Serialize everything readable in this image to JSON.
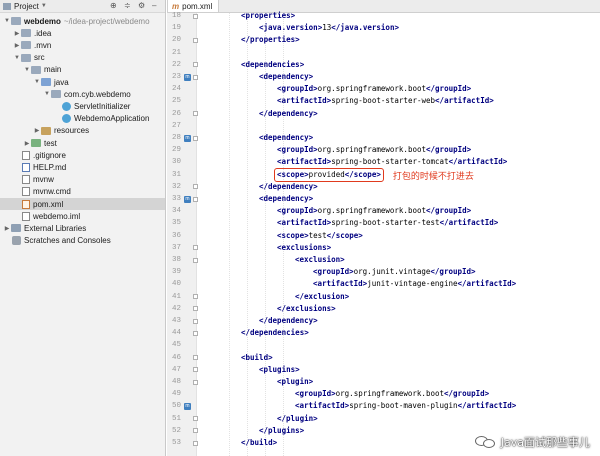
{
  "project_panel": {
    "title": "Project",
    "toolbar_icons": [
      "globe-icon",
      "split-icon",
      "gear-icon",
      "minimize-icon"
    ],
    "tree": [
      {
        "label": "webdemo",
        "path": "~/idea-project/webdemo",
        "depth": 0,
        "icon": "folder",
        "expanded": true,
        "bold": true
      },
      {
        "label": ".idea",
        "depth": 1,
        "icon": "folder",
        "expanded": false
      },
      {
        "label": ".mvn",
        "depth": 1,
        "icon": "folder",
        "expanded": false
      },
      {
        "label": "src",
        "depth": 1,
        "icon": "folder",
        "expanded": true
      },
      {
        "label": "main",
        "depth": 2,
        "icon": "folder",
        "expanded": true
      },
      {
        "label": "java",
        "depth": 3,
        "icon": "folder-src",
        "expanded": true
      },
      {
        "label": "com.cyb.webdemo",
        "depth": 4,
        "icon": "folder",
        "expanded": true
      },
      {
        "label": "ServletInitializer",
        "depth": 5,
        "icon": "class"
      },
      {
        "label": "WebdemoApplication",
        "depth": 5,
        "icon": "class"
      },
      {
        "label": "resources",
        "depth": 3,
        "icon": "folder-res",
        "expanded": false
      },
      {
        "label": "test",
        "depth": 2,
        "icon": "folder-test",
        "expanded": false
      },
      {
        "label": ".gitignore",
        "depth": 1,
        "icon": "file"
      },
      {
        "label": "HELP.md",
        "depth": 1,
        "icon": "file-md"
      },
      {
        "label": "mvnw",
        "depth": 1,
        "icon": "file"
      },
      {
        "label": "mvnw.cmd",
        "depth": 1,
        "icon": "file"
      },
      {
        "label": "pom.xml",
        "depth": 1,
        "icon": "file-xml",
        "selected": true
      },
      {
        "label": "webdemo.iml",
        "depth": 1,
        "icon": "file"
      },
      {
        "label": "External Libraries",
        "depth": 0,
        "icon": "folder-lib",
        "expanded": false
      },
      {
        "label": "Scratches and Consoles",
        "depth": 0,
        "icon": "scratch"
      }
    ]
  },
  "editor": {
    "tab_label": "pom.xml",
    "lines": [
      {
        "n": 18,
        "indent": 1,
        "parts": [
          [
            "t",
            "<properties>"
          ]
        ]
      },
      {
        "n": 19,
        "indent": 2,
        "parts": [
          [
            "t",
            "<java.version>"
          ],
          [
            "x",
            "13"
          ],
          [
            "t",
            "</java.version>"
          ]
        ]
      },
      {
        "n": 20,
        "indent": 1,
        "parts": [
          [
            "t",
            "</properties>"
          ]
        ]
      },
      {
        "n": 21,
        "indent": 0,
        "parts": []
      },
      {
        "n": 22,
        "indent": 1,
        "parts": [
          [
            "t",
            "<dependencies>"
          ]
        ]
      },
      {
        "n": 23,
        "indent": 2,
        "parts": [
          [
            "t",
            "<dependency>"
          ]
        ],
        "marker": true
      },
      {
        "n": 24,
        "indent": 3,
        "parts": [
          [
            "t",
            "<groupId>"
          ],
          [
            "x",
            "org.springframework.boot"
          ],
          [
            "t",
            "</groupId>"
          ]
        ]
      },
      {
        "n": 25,
        "indent": 3,
        "parts": [
          [
            "t",
            "<artifactId>"
          ],
          [
            "x",
            "spring-boot-starter-web"
          ],
          [
            "t",
            "</artifactId>"
          ]
        ]
      },
      {
        "n": 26,
        "indent": 2,
        "parts": [
          [
            "t",
            "</dependency>"
          ]
        ]
      },
      {
        "n": 27,
        "indent": 0,
        "parts": []
      },
      {
        "n": 28,
        "indent": 2,
        "parts": [
          [
            "t",
            "<dependency>"
          ]
        ],
        "marker": true
      },
      {
        "n": 29,
        "indent": 3,
        "parts": [
          [
            "t",
            "<groupId>"
          ],
          [
            "x",
            "org.springframework.boot"
          ],
          [
            "t",
            "</groupId>"
          ]
        ]
      },
      {
        "n": 30,
        "indent": 3,
        "parts": [
          [
            "t",
            "<artifactId>"
          ],
          [
            "x",
            "spring-boot-starter-tomcat"
          ],
          [
            "t",
            "</artifactId>"
          ]
        ]
      },
      {
        "n": 31,
        "indent": 3,
        "parts": [
          [
            "t",
            "<scope>"
          ],
          [
            "x",
            "provided"
          ],
          [
            "t",
            "</scope>"
          ]
        ],
        "highlight": true
      },
      {
        "n": 32,
        "indent": 2,
        "parts": [
          [
            "t",
            "</dependency>"
          ]
        ]
      },
      {
        "n": 33,
        "indent": 2,
        "parts": [
          [
            "t",
            "<dependency>"
          ]
        ],
        "marker": true
      },
      {
        "n": 34,
        "indent": 3,
        "parts": [
          [
            "t",
            "<groupId>"
          ],
          [
            "x",
            "org.springframework.boot"
          ],
          [
            "t",
            "</groupId>"
          ]
        ]
      },
      {
        "n": 35,
        "indent": 3,
        "parts": [
          [
            "t",
            "<artifactId>"
          ],
          [
            "x",
            "spring-boot-starter-test"
          ],
          [
            "t",
            "</artifactId>"
          ]
        ]
      },
      {
        "n": 36,
        "indent": 3,
        "parts": [
          [
            "t",
            "<scope>"
          ],
          [
            "x",
            "test"
          ],
          [
            "t",
            "</scope>"
          ]
        ]
      },
      {
        "n": 37,
        "indent": 3,
        "parts": [
          [
            "t",
            "<exclusions>"
          ]
        ]
      },
      {
        "n": 38,
        "indent": 4,
        "parts": [
          [
            "t",
            "<exclusion>"
          ]
        ]
      },
      {
        "n": 39,
        "indent": 5,
        "parts": [
          [
            "t",
            "<groupId>"
          ],
          [
            "x",
            "org.junit.vintage"
          ],
          [
            "t",
            "</groupId>"
          ]
        ]
      },
      {
        "n": 40,
        "indent": 5,
        "parts": [
          [
            "t",
            "<artifactId>"
          ],
          [
            "x",
            "junit-vintage-engine"
          ],
          [
            "t",
            "</artifactId>"
          ]
        ]
      },
      {
        "n": 41,
        "indent": 4,
        "parts": [
          [
            "t",
            "</exclusion>"
          ]
        ]
      },
      {
        "n": 42,
        "indent": 3,
        "parts": [
          [
            "t",
            "</exclusions>"
          ]
        ]
      },
      {
        "n": 43,
        "indent": 2,
        "parts": [
          [
            "t",
            "</dependency>"
          ]
        ]
      },
      {
        "n": 44,
        "indent": 1,
        "parts": [
          [
            "t",
            "</dependencies>"
          ]
        ]
      },
      {
        "n": 45,
        "indent": 0,
        "parts": []
      },
      {
        "n": 46,
        "indent": 1,
        "parts": [
          [
            "t",
            "<build>"
          ]
        ]
      },
      {
        "n": 47,
        "indent": 2,
        "parts": [
          [
            "t",
            "<plugins>"
          ]
        ]
      },
      {
        "n": 48,
        "indent": 3,
        "parts": [
          [
            "t",
            "<plugin>"
          ]
        ]
      },
      {
        "n": 49,
        "indent": 4,
        "parts": [
          [
            "t",
            "<groupId>"
          ],
          [
            "x",
            "org.springframework.boot"
          ],
          [
            "t",
            "</groupId>"
          ]
        ]
      },
      {
        "n": 50,
        "indent": 4,
        "parts": [
          [
            "t",
            "<artifactId>"
          ],
          [
            "x",
            "spring-boot-maven-plugin"
          ],
          [
            "t",
            "</artifactId>"
          ]
        ],
        "marker": true
      },
      {
        "n": 51,
        "indent": 3,
        "parts": [
          [
            "t",
            "</plugin>"
          ]
        ]
      },
      {
        "n": 52,
        "indent": 2,
        "parts": [
          [
            "t",
            "</plugins>"
          ]
        ]
      },
      {
        "n": 53,
        "indent": 1,
        "parts": [
          [
            "t",
            "</build>"
          ]
        ]
      }
    ]
  },
  "annotation": {
    "text": "打包的时候不打进去",
    "color": "#e03a1e"
  },
  "watermark": {
    "text": "Java面试那些事儿",
    "icon": "wechat-icon"
  },
  "colors": {
    "tag": "#000080",
    "text": "#000000",
    "line_number": "#999999",
    "gutter_bg": "#f0f0f0",
    "panel_bg": "#f2f2f2",
    "selection_bg": "#d4d4d4"
  }
}
